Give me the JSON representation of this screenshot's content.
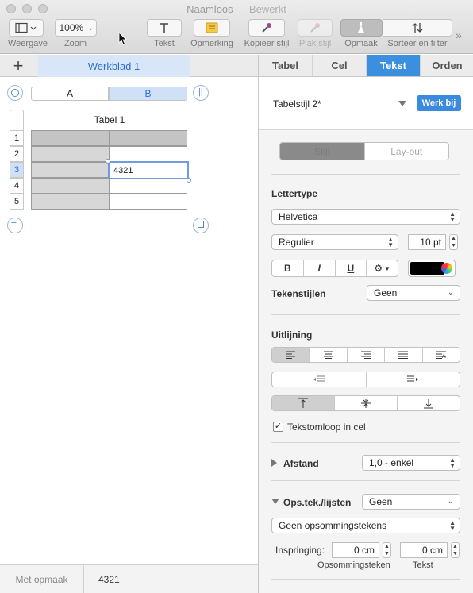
{
  "window": {
    "title": "Naamloos",
    "separator": "—",
    "edited": "Bewerkt"
  },
  "toolbar": {
    "view_label": "Weergave",
    "zoom_value": "100%",
    "zoom_label": "Zoom",
    "text_label": "Tekst",
    "comment_label": "Opmerking",
    "copy_style_label": "Kopieer stijl",
    "paste_style_label": "Plak stijl",
    "format_label": "Opmaak",
    "sort_label": "Sorteer en filter",
    "overflow": "»"
  },
  "sheets": {
    "add": "+",
    "active_tab": "Werkblad 1"
  },
  "table": {
    "title": "Tabel 1",
    "columns": [
      "A",
      "B"
    ],
    "rows": [
      "1",
      "2",
      "3",
      "4",
      "5"
    ],
    "selected_cell_value": "4321"
  },
  "status": {
    "format": "Met opmaak",
    "value": "4321"
  },
  "inspector": {
    "tabs": [
      "Tabel",
      "Cel",
      "Tekst",
      "Orden"
    ],
    "table_style": "Tabelstijl 2*",
    "update_button": "Werk bij",
    "style_seg": [
      "Stijl",
      "Lay-out"
    ],
    "font_section": "Lettertype",
    "font_family": "Helvetica",
    "font_weight": "Regulier",
    "font_size": "10 pt",
    "bold": "B",
    "italic": "I",
    "underline": "U",
    "gear": "⚙",
    "char_styles_label": "Tekenstijlen",
    "char_styles_value": "Geen",
    "alignment_section": "Uitlijning",
    "wrap_label": "Tekstomloop in cel",
    "spacing_label": "Afstand",
    "spacing_value": "1,0 - enkel",
    "bullets_label": "Ops.tek./lijsten",
    "bullets_value": "Geen",
    "bullets_type": "Geen opsommingstekens",
    "indent_label": "Inspringing:",
    "indent_bullets_value": "0 cm",
    "indent_text_value": "0 cm",
    "indent_bullets_caption": "Opsommingsteken",
    "indent_text_caption": "Tekst"
  },
  "colors": {
    "accent": "#3b8fdf",
    "text_color": "#000000"
  }
}
